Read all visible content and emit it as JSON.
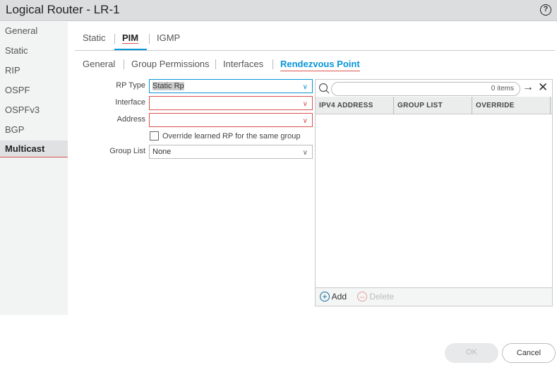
{
  "window": {
    "title": "Logical Router - LR-1",
    "help_icon": "?"
  },
  "sidebar": {
    "items": [
      {
        "label": "General"
      },
      {
        "label": "Static"
      },
      {
        "label": "RIP"
      },
      {
        "label": "OSPF"
      },
      {
        "label": "OSPFv3"
      },
      {
        "label": "BGP"
      },
      {
        "label": "Multicast"
      }
    ]
  },
  "tabs": [
    {
      "label": "Static"
    },
    {
      "label": "PIM"
    },
    {
      "label": "IGMP"
    }
  ],
  "subtabs": [
    {
      "label": "General"
    },
    {
      "label": "Group Permissions"
    },
    {
      "label": "Interfaces"
    },
    {
      "label": "Rendezvous Point"
    }
  ],
  "form": {
    "rp_type_label": "RP Type",
    "rp_type_value": "Static Rp",
    "interface_label": "Interface",
    "interface_value": "",
    "address_label": "Address",
    "address_value": "",
    "override_label": "Override learned RP for the same group",
    "group_list_label": "Group List",
    "group_list_value": "None"
  },
  "grid": {
    "items_count": "0 items",
    "columns": [
      "IPV4 ADDRESS",
      "GROUP LIST",
      "OVERRIDE"
    ],
    "add_label": "Add",
    "delete_label": "Delete"
  },
  "footer": {
    "ok_label": "OK",
    "cancel_label": "Cancel"
  },
  "colors": {
    "accent": "#0795d9",
    "error": "#d9534f"
  }
}
